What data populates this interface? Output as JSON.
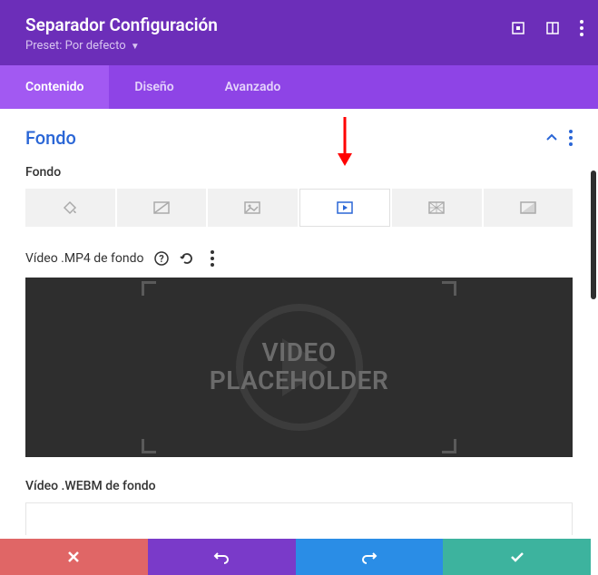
{
  "header": {
    "title": "Separador Configuración",
    "preset_prefix": "Preset:",
    "preset_value": "Por defecto"
  },
  "tabs": {
    "content": "Contenido",
    "design": "Diseño",
    "advanced": "Avanzado"
  },
  "section": {
    "title": "Fondo"
  },
  "fields": {
    "background_label": "Fondo",
    "video_mp4_label": "Vídeo .MP4 de fondo",
    "video_webm_label": "Vídeo .WEBM de fondo",
    "video_placeholder_line1": "VIDEO",
    "video_placeholder_line2": "PLACEHOLDER"
  }
}
